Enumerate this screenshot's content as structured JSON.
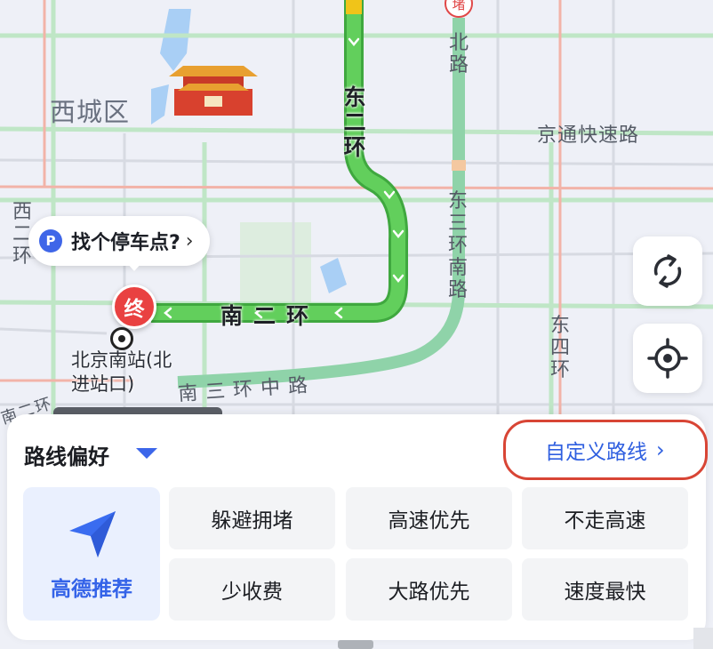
{
  "map": {
    "district": "西城区",
    "roads": {
      "beilu": "北路",
      "jingtong": "京通快速路",
      "xi_er_huan": "西二环",
      "dong_san_huan_nan_lu": "东三环南路",
      "dong_si_huan": "东四环",
      "nan_san_huan_zhong_lu": "南三环中路",
      "nan_er_huan_corner": "南二环"
    },
    "route_labels": {
      "dong_er_huan": "东二环",
      "nan_er_huan": "南二环"
    },
    "station_line1": "北京南站(北",
    "station_line2": "进站口)",
    "parking_prompt": "找个停车点?",
    "parking_chevron": "›",
    "parking_icon_glyph": "P",
    "end_marker": "终",
    "top_badge": "堵"
  },
  "controls": {
    "refresh_icon": "refresh-icon",
    "locate_icon": "locate-icon"
  },
  "panel": {
    "title": "路线偏好",
    "custom_route": "自定义路线",
    "custom_chevron": "›",
    "recommended": "高德推荐",
    "options": [
      "躲避拥堵",
      "高速优先",
      "不走高速",
      "少收费",
      "大路优先",
      "速度最快"
    ]
  },
  "colors": {
    "route": "#4fc24f",
    "accent": "#3463e8",
    "highlight_border": "#d84535",
    "end_marker": "#e94141"
  }
}
